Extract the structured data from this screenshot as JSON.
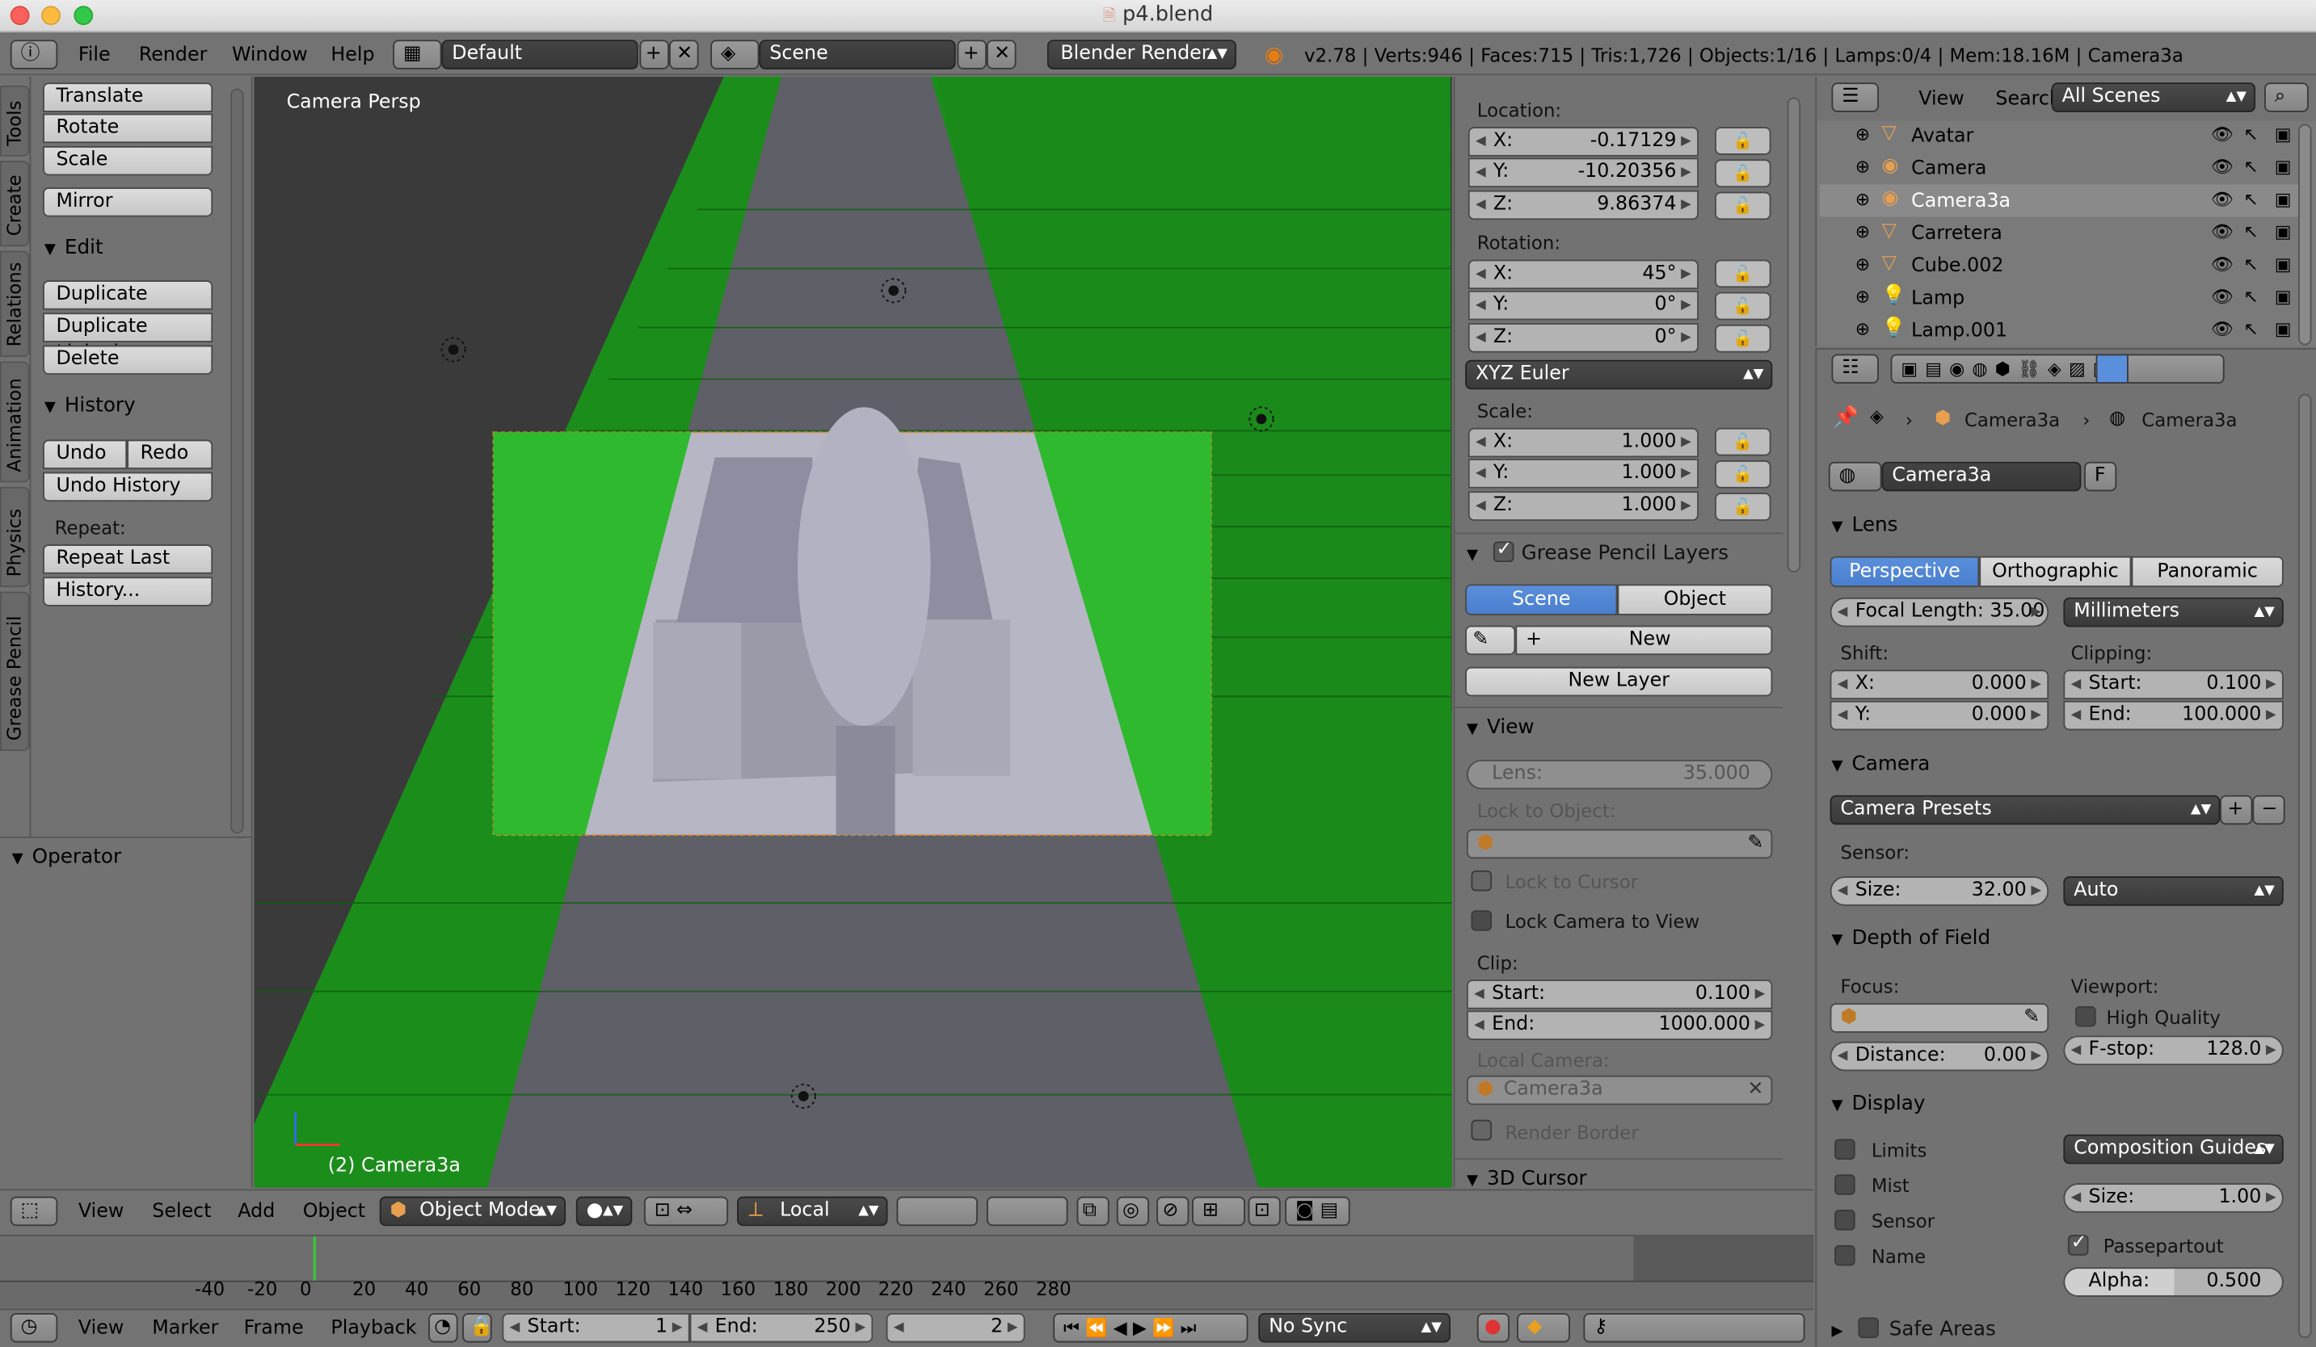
{
  "window": {
    "title": "p4.blend"
  },
  "header": {
    "menus": [
      "File",
      "Render",
      "Window",
      "Help"
    ],
    "layout": "Default",
    "scene": "Scene",
    "engine": "Blender Render",
    "stats": "v2.78 | Verts:946 | Faces:715 | Tris:1,726 | Objects:1/16 | Lamps:0/4 | Mem:18.16M | Camera3a"
  },
  "toolshelf": {
    "tabs": [
      "Tools",
      "Create",
      "Relations",
      "Animation",
      "Physics",
      "Grease Pencil"
    ],
    "transform": [
      "Translate",
      "Rotate",
      "Scale"
    ],
    "mirror": "Mirror",
    "edit_title": "Edit",
    "edit": [
      "Duplicate",
      "Duplicate Linked",
      "Delete"
    ],
    "history_title": "History",
    "undo": "Undo",
    "redo": "Redo",
    "undo_history": "Undo History",
    "repeat_label": "Repeat:",
    "repeat_last": "Repeat Last",
    "history_btn": "History...",
    "operator_title": "Operator"
  },
  "viewport": {
    "label": "Camera Persp",
    "object_label": "(2) Camera3a",
    "colors": {
      "grass": "#1fa91f",
      "road": "#5f5f67",
      "background": "#3a3a3a"
    }
  },
  "properties_panel": {
    "location_label": "Location:",
    "location": {
      "x": "-0.17129",
      "y": "-10.20356",
      "z": "9.86374"
    },
    "rotation_label": "Rotation:",
    "rotation": {
      "x": "45°",
      "y": "0°",
      "z": "0°"
    },
    "rotation_mode": "XYZ Euler",
    "scale_label": "Scale:",
    "scale": {
      "x": "1.000",
      "y": "1.000",
      "z": "1.000"
    },
    "gp_title": "Grease Pencil Layers",
    "gp_scene": "Scene",
    "gp_object": "Object",
    "gp_new": "New",
    "gp_new_layer": "New Layer",
    "view_title": "View",
    "lens_label": "Lens:",
    "lens": "35.000",
    "lock_object_label": "Lock to Object:",
    "lock_cursor": "Lock to Cursor",
    "lock_camera": "Lock Camera to View",
    "clip_label": "Clip:",
    "clip_start_label": "Start:",
    "clip_start": "0.100",
    "clip_end_label": "End:",
    "clip_end": "1000.000",
    "local_camera_label": "Local Camera:",
    "local_camera": "Camera3a",
    "render_border": "Render Border",
    "cursor_title": "3D Cursor",
    "axis": {
      "x": "X:",
      "y": "Y:",
      "z": "Z:"
    }
  },
  "outliner": {
    "menus": [
      "View",
      "Search"
    ],
    "filter": "All Scenes",
    "items": [
      "Avatar",
      "Camera",
      "Camera3a",
      "Carretera",
      "Cube.002",
      "Lamp",
      "Lamp.001"
    ],
    "selected": "Camera3a"
  },
  "camera_props": {
    "breadcrumb": [
      "Camera3a",
      "Camera3a"
    ],
    "datablock": "Camera3a",
    "fake_user": "F",
    "lens_title": "Lens",
    "lens_types": [
      "Perspective",
      "Orthographic",
      "Panoramic"
    ],
    "focal_length": "Focal Length: 35.00",
    "units": "Millimeters",
    "shift_label": "Shift:",
    "shift_x": "0.000",
    "shift_y": "0.000",
    "clipping_label": "Clipping:",
    "clip_start_label": "Start:",
    "clip_start": "0.100",
    "clip_end_label": "End:",
    "clip_end": "100.000",
    "camera_title": "Camera",
    "presets": "Camera Presets",
    "sensor_label": "Sensor:",
    "size_label": "Size:",
    "sensor_size": "32.00",
    "sensor_fit": "Auto",
    "dof_title": "Depth of Field",
    "focus_label": "Focus:",
    "viewport_label": "Viewport:",
    "high_quality": "High Quality",
    "distance_label": "Distance:",
    "distance": "0.00",
    "fstop_label": "F-stop:",
    "fstop": "128.0",
    "display_title": "Display",
    "limits": "Limits",
    "mist": "Mist",
    "sensor": "Sensor",
    "name": "Name",
    "guides": "Composition Guides",
    "display_size_label": "Size:",
    "display_size": "1.00",
    "passepartout": "Passepartout",
    "alpha_label": "Alpha:",
    "alpha": "0.500",
    "safe_areas": "Safe Areas",
    "axis": {
      "x": "X:",
      "y": "Y:"
    }
  },
  "view3d_header": {
    "menus": [
      "View",
      "Select",
      "Add",
      "Object"
    ],
    "mode": "Object Mode",
    "orientation": "Local"
  },
  "timeline": {
    "ticks": [
      "-40",
      "-20",
      "0",
      "20",
      "40",
      "60",
      "80",
      "100",
      "120",
      "140",
      "160",
      "180",
      "200",
      "220",
      "240",
      "260",
      "280"
    ],
    "current_frame_value": 2,
    "menus": [
      "View",
      "Marker",
      "Frame",
      "Playback"
    ],
    "start_label": "Start:",
    "start": "1",
    "end_label": "End:",
    "end": "250",
    "current": "2",
    "sync": "No Sync"
  }
}
